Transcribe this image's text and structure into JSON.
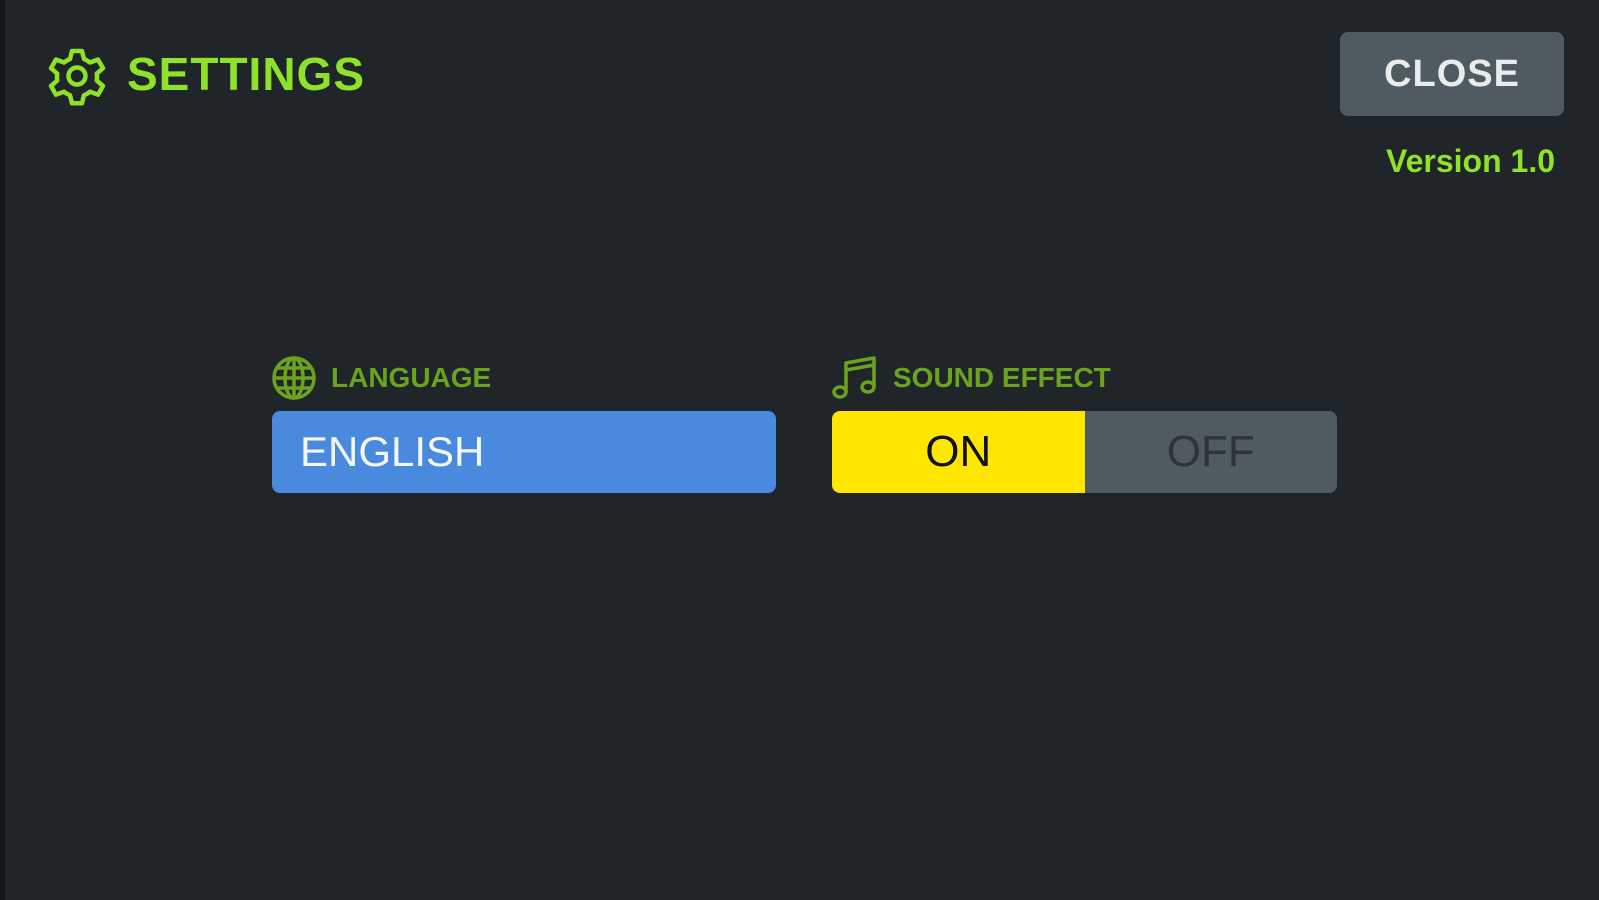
{
  "header": {
    "title": "SETTINGS",
    "icon": "gear-icon"
  },
  "close_button": {
    "label": "CLOSE"
  },
  "version": "Version 1.0",
  "language": {
    "label": "LANGUAGE",
    "icon": "globe-icon",
    "value": "ENGLISH"
  },
  "sound_effect": {
    "label": "SOUND EFFECT",
    "icon": "music-note-icon",
    "on_label": "ON",
    "off_label": "OFF",
    "selected": "ON"
  },
  "colors": {
    "background": "#202529",
    "accent_green": "#8fe22a",
    "language_blue": "#4a8ade",
    "toggle_on_yellow": "#ffe600",
    "button_gray": "#4f5b60"
  }
}
